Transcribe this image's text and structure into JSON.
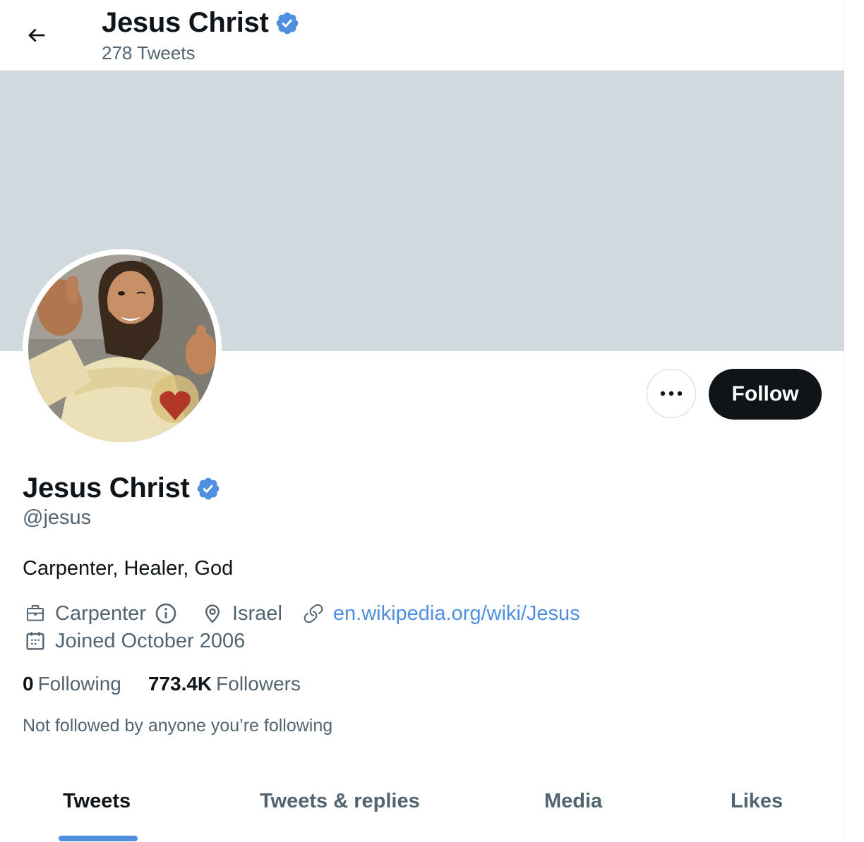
{
  "header": {
    "title": "Jesus Christ",
    "tweet_count": "278 Tweets",
    "verified_icon": "verified-badge-icon",
    "back_icon": "arrow-left-icon"
  },
  "profile": {
    "name": "Jesus Christ",
    "handle": "@jesus",
    "bio": "Carpenter, Healer, God",
    "profession": "Carpenter",
    "location": "Israel",
    "website": "en.wikipedia.org/wiki/Jesus",
    "joined": "Joined October 2006",
    "following_count": "0",
    "following_label": "Following",
    "followers_count": "773.4K",
    "followers_label": "Followers",
    "not_followed_note": "Not followed by anyone you’re following"
  },
  "actions": {
    "follow_label": "Follow",
    "more_icon": "more-horizontal-icon"
  },
  "tabs": [
    {
      "label": "Tweets",
      "active": true
    },
    {
      "label": "Tweets & replies",
      "active": false
    },
    {
      "label": "Media",
      "active": false
    },
    {
      "label": "Likes",
      "active": false
    }
  ],
  "colors": {
    "accent": "#4f8fe0",
    "banner": "#cfd9de",
    "text_primary": "#0f1419",
    "text_secondary": "#536471"
  }
}
